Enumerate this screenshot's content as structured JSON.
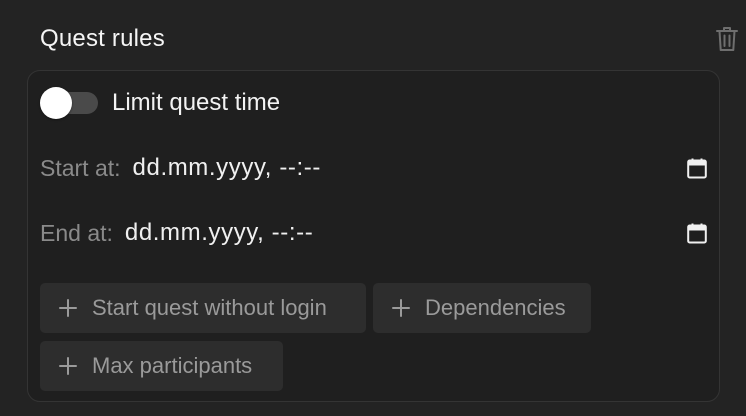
{
  "header": {
    "title": "Quest rules",
    "delete_icon": "trash-icon"
  },
  "toggle": {
    "label": "Limit quest time",
    "enabled": false
  },
  "start": {
    "label": "Start at:",
    "value": "dd.mm.yyyy, --:--",
    "icon": "calendar-icon"
  },
  "end": {
    "label": "End at:",
    "value": "dd.mm.yyyy, --:--",
    "icon": "calendar-icon"
  },
  "options": [
    {
      "label": "Start quest without login",
      "icon": "plus-icon"
    },
    {
      "label": "Dependencies",
      "icon": "plus-icon"
    },
    {
      "label": "Max participants",
      "icon": "plus-icon"
    }
  ],
  "colors": {
    "background": "#232323",
    "card": "#1f1f1f",
    "chip": "#2d2d2d",
    "text": "#f5f5f5",
    "muted": "#8a8a8a"
  }
}
